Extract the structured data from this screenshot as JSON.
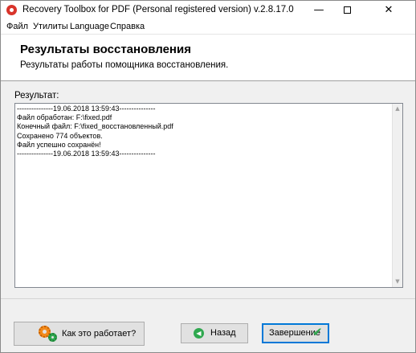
{
  "window": {
    "title": "Recovery Toolbox for PDF (Personal registered version) v.2.8.17.0",
    "minimize_glyph": "—",
    "close_glyph": "✕"
  },
  "menu": {
    "items": [
      {
        "label": "Файл"
      },
      {
        "label": "Утилиты"
      },
      {
        "label": "Language"
      },
      {
        "label": "Справка"
      }
    ]
  },
  "header": {
    "title": "Результаты восстановления",
    "subtitle": "Результаты работы помощника восстановления."
  },
  "result": {
    "label": "Результат:",
    "lines": [
      "---------------19.06.2018 13:59:43---------------",
      "Файл обработан: F:\\fixed.pdf",
      "Конечный файл: F:\\fixed_восстановленный.pdf",
      "Сохранено 774 объектов.",
      "Файл успешно сохранён!",
      "---------------19.06.2018 13:59:43---------------"
    ]
  },
  "buttons": {
    "how_it_works": "Как это работает?",
    "back": "Назад",
    "finish": "Завершение"
  },
  "icons": {
    "app": "recovery-toolbox-app-icon",
    "how": "gears-icon",
    "back": "back-arrow-icon",
    "finish": "check-icon"
  },
  "colors": {
    "accent": "#0078d7",
    "green": "#2fa84f",
    "orange": "#f28a1a",
    "app_red": "#d9342b"
  }
}
